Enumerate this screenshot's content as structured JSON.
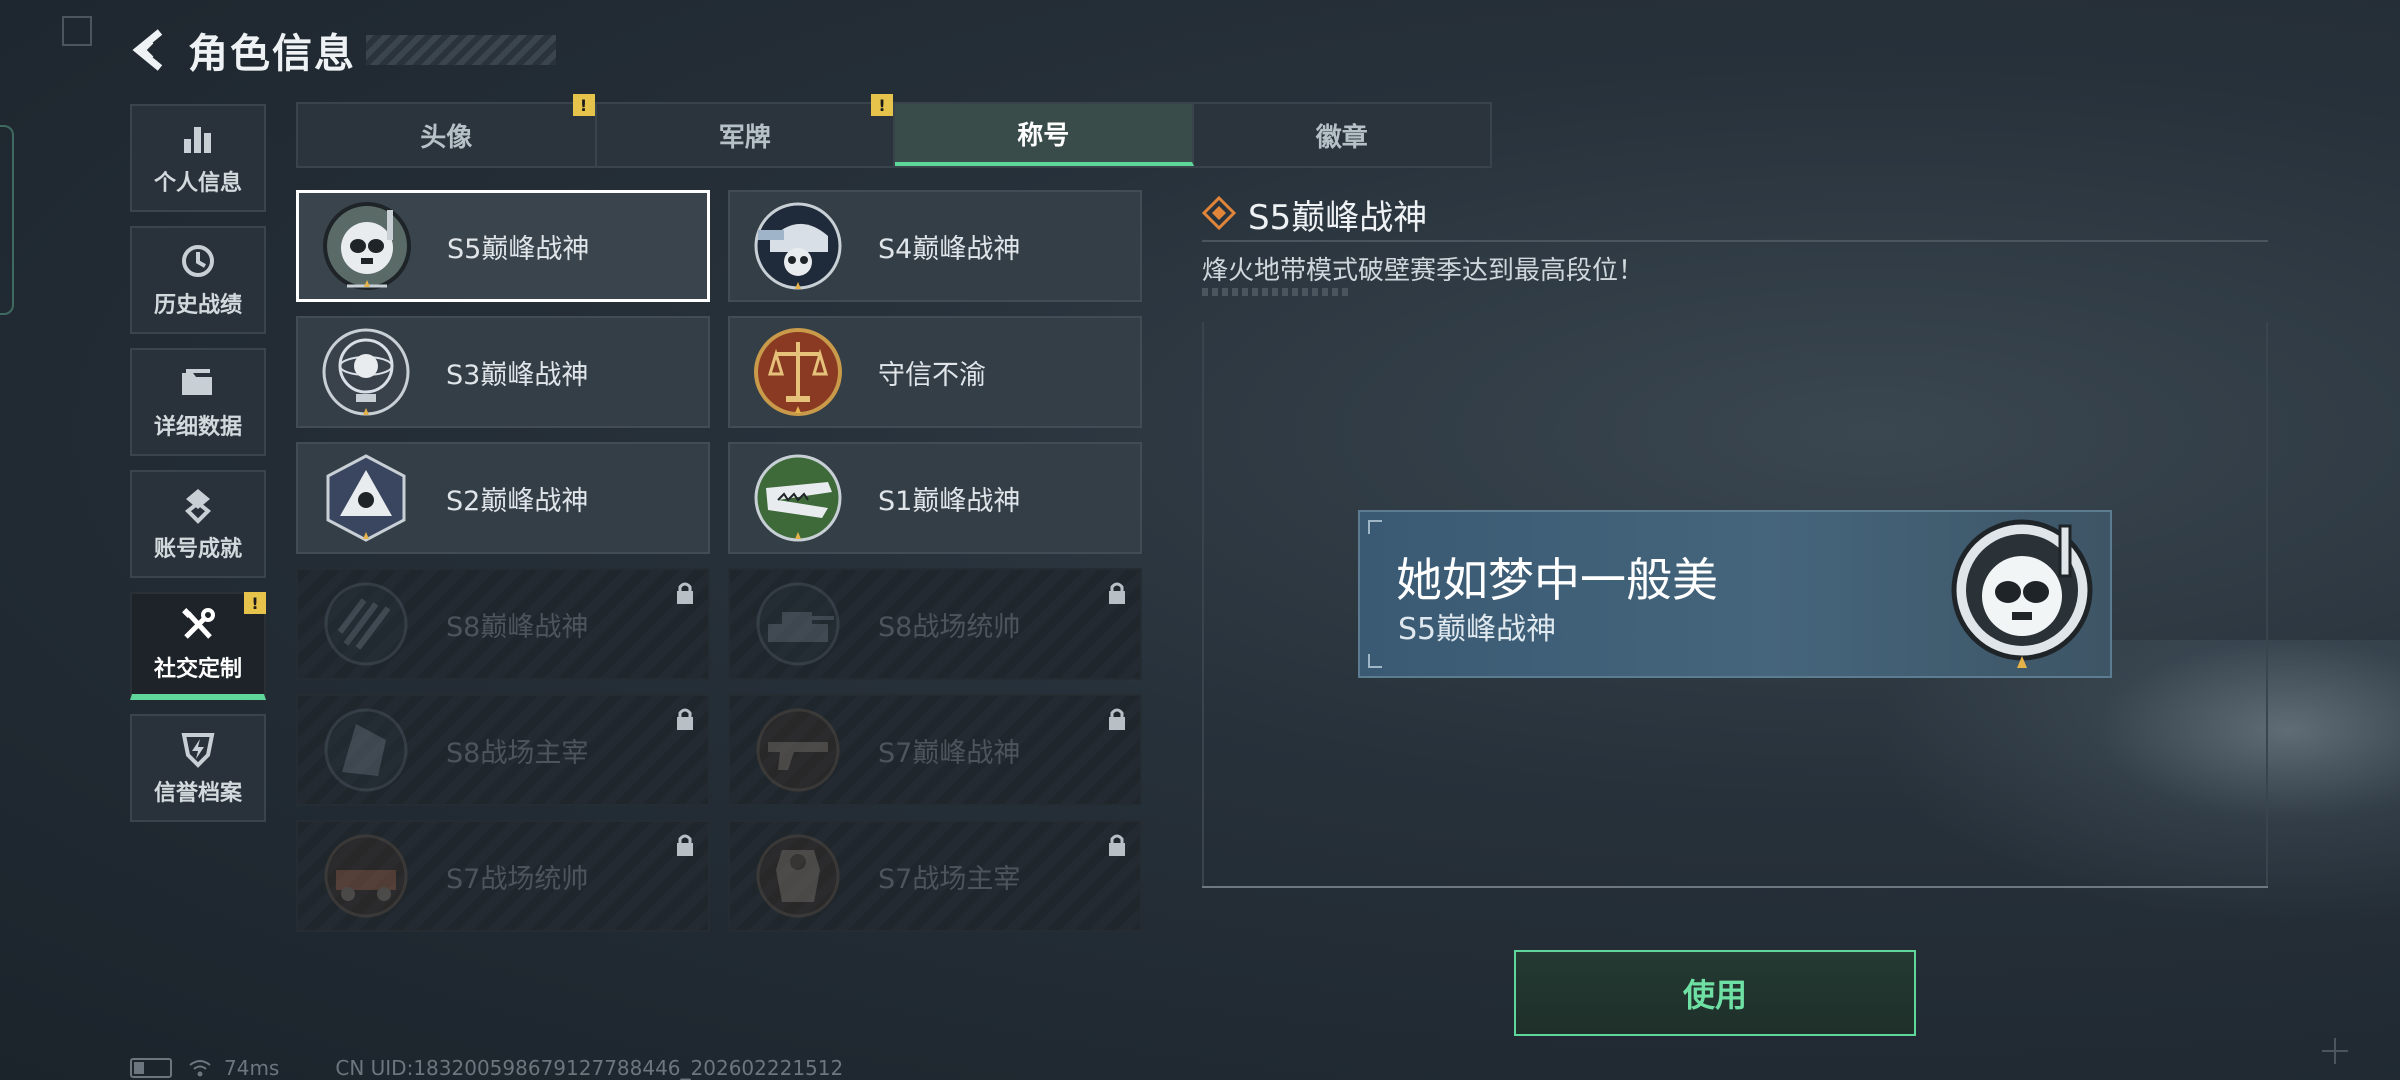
{
  "header": {
    "title": "角色信息"
  },
  "sidebar": {
    "items": [
      {
        "label": "个人信息",
        "icon": "bar-chart-icon",
        "active": false,
        "badge": ""
      },
      {
        "label": "历史战绩",
        "icon": "history-clock-icon",
        "active": false,
        "badge": ""
      },
      {
        "label": "详细数据",
        "icon": "folder-icon",
        "active": false,
        "badge": ""
      },
      {
        "label": "账号成就",
        "icon": "achievement-icon",
        "active": false,
        "badge": ""
      },
      {
        "label": "社交定制",
        "icon": "wrench-screwdriver-icon",
        "active": true,
        "badge": "!"
      },
      {
        "label": "信誉档案",
        "icon": "shield-bolt-icon",
        "active": false,
        "badge": ""
      }
    ]
  },
  "tabs": [
    {
      "label": "头像",
      "badge": "!"
    },
    {
      "label": "军牌",
      "badge": "!"
    },
    {
      "label": "称号",
      "badge": "",
      "active": true
    },
    {
      "label": "徽章",
      "badge": ""
    }
  ],
  "titles": [
    {
      "name": "S5巅峰战神",
      "emblem": "skull-diver-emblem",
      "locked": false,
      "selected": true
    },
    {
      "name": "S4巅峰战神",
      "emblem": "skull-helmet-emblem",
      "locked": false,
      "selected": false
    },
    {
      "name": "S3巅峰战神",
      "emblem": "skull-globe-emblem",
      "locked": false,
      "selected": false
    },
    {
      "name": "守信不渝",
      "emblem": "scales-emblem",
      "locked": false,
      "selected": false
    },
    {
      "name": "S2巅峰战神",
      "emblem": "skull-triangle-emblem",
      "locked": false,
      "selected": false
    },
    {
      "name": "S1巅峰战神",
      "emblem": "crocodile-emblem",
      "locked": false,
      "selected": false
    },
    {
      "name": "S8巅峰战神",
      "emblem": "slash-emblem",
      "locked": true,
      "selected": false
    },
    {
      "name": "S8战场统帅",
      "emblem": "tank-emblem",
      "locked": true,
      "selected": false
    },
    {
      "name": "S8战场主宰",
      "emblem": "building-emblem",
      "locked": true,
      "selected": false
    },
    {
      "name": "S7巅峰战神",
      "emblem": "pistol-emblem",
      "locked": true,
      "selected": false
    },
    {
      "name": "S7战场统帅",
      "emblem": "vehicle-emblem",
      "locked": true,
      "selected": false
    },
    {
      "name": "S7战场主宰",
      "emblem": "armor-emblem",
      "locked": true,
      "selected": false
    }
  ],
  "detail": {
    "title": "S5巅峰战神",
    "description": "烽火地带模式破壁赛季达到最高段位！",
    "preview": {
      "nickname": "她如梦中一般美",
      "title": "S5巅峰战神"
    },
    "use_label": "使用"
  },
  "status": {
    "ping": "74ms",
    "uid": "CN UID:183200598679127788446_202602221512"
  },
  "colors": {
    "accent": "#5fd79a",
    "badge": "#e6c34a",
    "detail_icon": "#e0853a"
  }
}
